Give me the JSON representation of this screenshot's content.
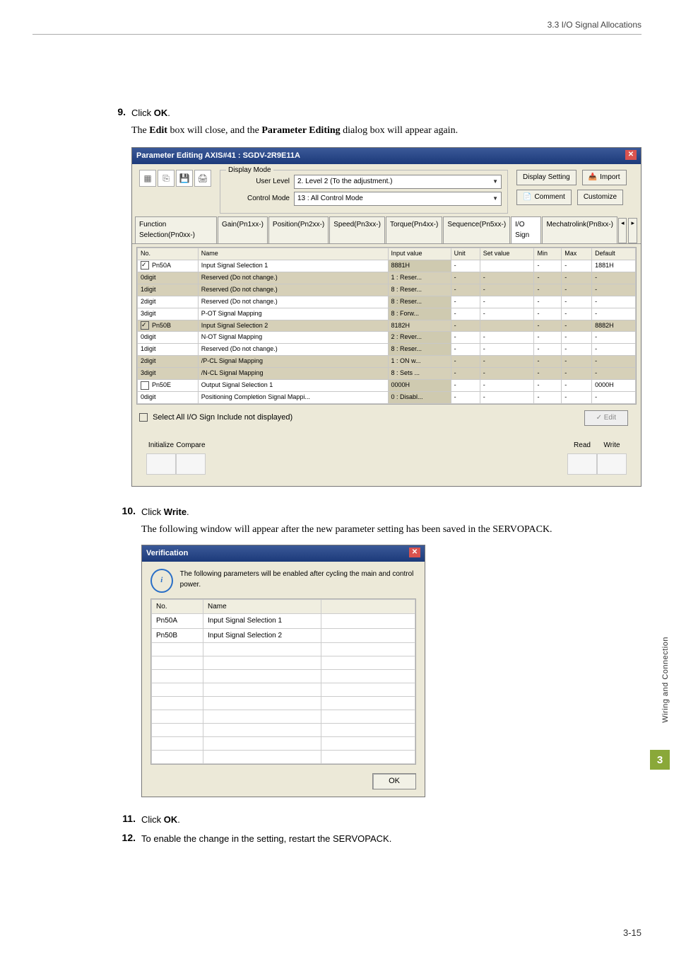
{
  "header": {
    "section": "3.3  I/O Signal Allocations"
  },
  "steps": {
    "s9_num": "9.",
    "s9_text1": "Click ",
    "s9_ok": "OK",
    "s9_text2": ".",
    "s9_body_a": "The ",
    "s9_body_b": "Edit",
    "s9_body_c": " box will close, and the ",
    "s9_body_d": "Parameter Editing",
    "s9_body_e": " dialog box will appear again.",
    "s10_num": "10.",
    "s10_text1": "Click ",
    "s10_write": "Write",
    "s10_text2": ".",
    "s10_body": "The following window will appear after the new parameter setting has been saved in the SERVOPACK.",
    "s11_num": "11.",
    "s11_text1": "Click ",
    "s11_ok": "OK",
    "s11_text2": ".",
    "s12_num": "12.",
    "s12_body": "To enable the change in the setting, restart the SERVOPACK."
  },
  "dialog1": {
    "title": "Parameter Editing  AXIS#41 : SGDV-2R9E11A",
    "display_mode_legend": "Display Mode",
    "user_level_label": "User Level",
    "user_level_value": "2. Level 2 (To the adjustment.)",
    "control_mode_label": "Control Mode",
    "control_mode_value": "13 : All Control Mode",
    "btn_display_setting": "Display Setting",
    "btn_import": "Import",
    "btn_comment": "Comment",
    "btn_customize": "Customize",
    "tabs": [
      "Function Selection(Pn0xx-)",
      "Gain(Pn1xx-)",
      "Position(Pn2xx-)",
      "Speed(Pn3xx-)",
      "Torque(Pn4xx-)",
      "Sequence(Pn5xx-)",
      "I/O Sign",
      "Mechatrolink(Pn8xx-)"
    ],
    "active_tab": "I/O Sign",
    "grid_headers": [
      "No.",
      "Name",
      "Input value",
      "Unit",
      "Set value",
      "Min",
      "Max",
      "Default"
    ],
    "rows": [
      {
        "no": "Pn50A",
        "name": "Input Signal Selection 1",
        "inp": "8881H",
        "unit": "-",
        "set": "",
        "min": "-",
        "max": "-",
        "def": "1881H",
        "chk": true,
        "shade": false
      },
      {
        "no": "0digit",
        "name": "Reserved (Do not change.)",
        "inp": "1 : Reser...",
        "unit": "-",
        "set": "-",
        "min": "-",
        "max": "-",
        "def": "-",
        "chk": null,
        "shade": true
      },
      {
        "no": "1digit",
        "name": "Reserved (Do not change.)",
        "inp": "8 : Reser...",
        "unit": "-",
        "set": "-",
        "min": "-",
        "max": "-",
        "def": "-",
        "chk": null,
        "shade": true
      },
      {
        "no": "2digit",
        "name": "Reserved (Do not change.)",
        "inp": "8 : Reser...",
        "unit": "-",
        "set": "-",
        "min": "-",
        "max": "-",
        "def": "-",
        "chk": null,
        "shade": false
      },
      {
        "no": "3digit",
        "name": "P-OT Signal Mapping",
        "inp": "8 : Forw...",
        "unit": "-",
        "set": "-",
        "min": "-",
        "max": "-",
        "def": "-",
        "chk": null,
        "shade": false
      },
      {
        "no": "Pn50B",
        "name": "Input Signal Selection 2",
        "inp": "8182H",
        "unit": "-",
        "set": "",
        "min": "-",
        "max": "-",
        "def": "8882H",
        "chk": true,
        "shade": true
      },
      {
        "no": "0digit",
        "name": "N-OT Signal Mapping",
        "inp": "2 : Rever...",
        "unit": "-",
        "set": "-",
        "min": "-",
        "max": "-",
        "def": "-",
        "chk": null,
        "shade": false
      },
      {
        "no": "1digit",
        "name": "Reserved (Do not change.)",
        "inp": "8 : Reser...",
        "unit": "-",
        "set": "-",
        "min": "-",
        "max": "-",
        "def": "-",
        "chk": null,
        "shade": false
      },
      {
        "no": "2digit",
        "name": "/P-CL Signal Mapping",
        "inp": "1 : ON w...",
        "unit": "-",
        "set": "-",
        "min": "-",
        "max": "-",
        "def": "-",
        "chk": null,
        "shade": true
      },
      {
        "no": "3digit",
        "name": "/N-CL Signal Mapping",
        "inp": "8 : Sets ...",
        "unit": "-",
        "set": "-",
        "min": "-",
        "max": "-",
        "def": "-",
        "chk": null,
        "shade": true
      },
      {
        "no": "Pn50E",
        "name": "Output Signal Selection 1",
        "inp": "0000H",
        "unit": "-",
        "set": "-",
        "min": "-",
        "max": "-",
        "def": "0000H",
        "chk": false,
        "shade": false
      },
      {
        "no": "0digit",
        "name": "Positioning Completion Signal Mappi...",
        "inp": "0 : Disabl...",
        "unit": "-",
        "set": "-",
        "min": "-",
        "max": "-",
        "def": "-",
        "chk": null,
        "shade": false
      }
    ],
    "select_all_label": "Select All I/O Sign Include not displayed)",
    "edit_btn": "✓ Edit",
    "actions": {
      "initialize": "Initialize",
      "compare": "Compare",
      "read": "Read",
      "write": "Write"
    }
  },
  "dialog2": {
    "title": "Verification",
    "info_text": "The following parameters will be enabled after cycling the main and control power.",
    "headers": [
      "No.",
      "Name"
    ],
    "rows": [
      {
        "no": "Pn50A",
        "name": "Input Signal Selection 1"
      },
      {
        "no": "Pn50B",
        "name": "Input Signal Selection 2"
      }
    ],
    "ok": "OK"
  },
  "side": {
    "label": "Wiring and Connection",
    "chapter": "3"
  },
  "footer": {
    "page": "3-15"
  }
}
